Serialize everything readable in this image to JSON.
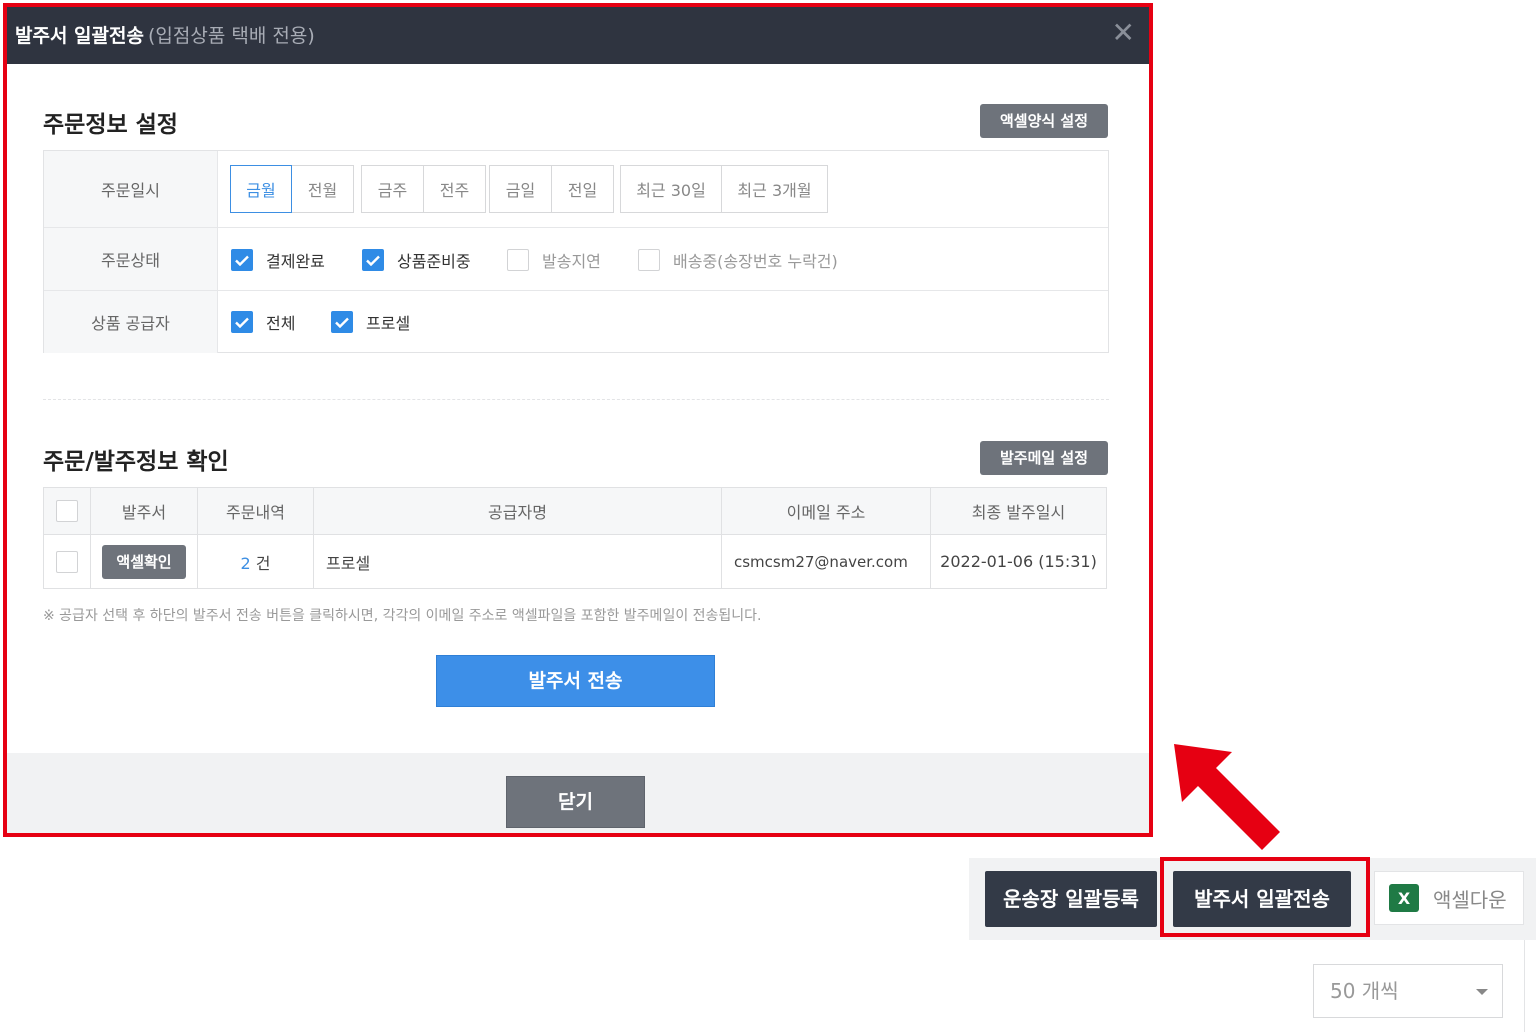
{
  "modal": {
    "title": "발주서 일괄전송",
    "subtitle": "(입점상품 택배 전용)",
    "close_symbol": "✕"
  },
  "order_settings": {
    "title": "주문정보 설정",
    "excel_format_button": "액셀양식 설정",
    "rows": {
      "date_label": "주문일시",
      "status_label": "주문상태",
      "supplier_label": "상품 공급자"
    },
    "period_buttons": [
      "금월",
      "전월",
      "금주",
      "전주",
      "금일",
      "전일",
      "최근 30일",
      "최근 3개월"
    ],
    "active_period": "금월",
    "statuses": [
      {
        "label": "결제완료",
        "checked": true
      },
      {
        "label": "상품준비중",
        "checked": true
      },
      {
        "label": "발송지연",
        "checked": false
      },
      {
        "label": "배송중(송장번호 누락건)",
        "checked": false
      }
    ],
    "suppliers": [
      {
        "label": "전체",
        "checked": true
      },
      {
        "label": "프로셀",
        "checked": true
      }
    ]
  },
  "order_confirm": {
    "title": "주문/발주정보 확인",
    "mail_settings_button": "발주메일 설정",
    "columns": [
      "발주서",
      "주문내역",
      "공급자명",
      "이메일 주소",
      "최종 발주일시"
    ],
    "rows": [
      {
        "action": "액셀확인",
        "count": "2",
        "count_unit": "건",
        "supplier": "프로셀",
        "email": "csmcsm27@naver.com",
        "last_sent": "2022-01-06 (15:31)"
      }
    ],
    "notice": "※ 공급자 선택 후 하단의 발주서 전송 버튼을 클릭하시면, 각각의 이메일 주소로 액셀파일을 포함한 발주메일이 전송됩니다.",
    "send_button": "발주서 전송"
  },
  "footer": {
    "close_button": "닫기"
  },
  "background": {
    "waybill_button": "운송장 일괄등록",
    "bulk_send_button": "발주서 일괄전송",
    "excel_download": "액셀다운",
    "excel_icon_letter": "X",
    "page_size": "50 개씩"
  },
  "colors": {
    "highlight": "#e60012",
    "primary": "#3d8fe8",
    "header_bg": "#2f3440",
    "checkbox_on": "#2f8be6"
  },
  "icons": {
    "close": "close-icon",
    "check": "check-icon",
    "excel": "excel-icon",
    "caret": "chevron-down-icon",
    "arrow": "arrow-icon"
  }
}
